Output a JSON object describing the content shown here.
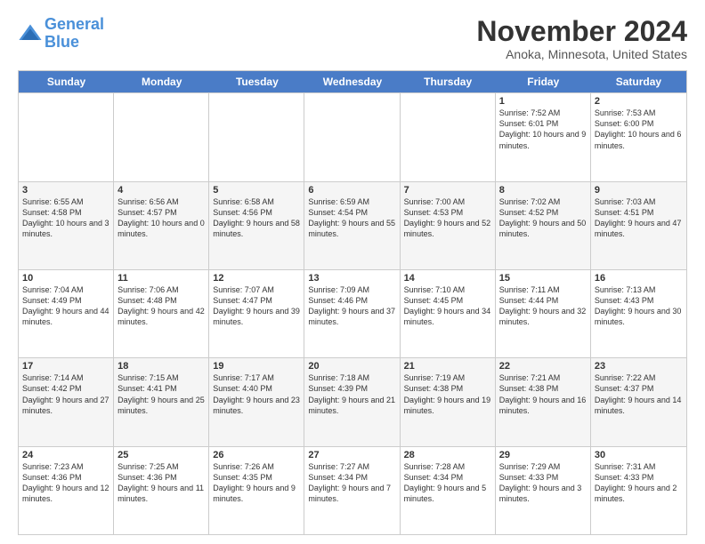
{
  "logo": {
    "line1": "General",
    "line2": "Blue"
  },
  "title": "November 2024",
  "location": "Anoka, Minnesota, United States",
  "days_of_week": [
    "Sunday",
    "Monday",
    "Tuesday",
    "Wednesday",
    "Thursday",
    "Friday",
    "Saturday"
  ],
  "weeks": [
    [
      {
        "day": "",
        "info": ""
      },
      {
        "day": "",
        "info": ""
      },
      {
        "day": "",
        "info": ""
      },
      {
        "day": "",
        "info": ""
      },
      {
        "day": "",
        "info": ""
      },
      {
        "day": "1",
        "info": "Sunrise: 7:52 AM\nSunset: 6:01 PM\nDaylight: 10 hours and 9 minutes."
      },
      {
        "day": "2",
        "info": "Sunrise: 7:53 AM\nSunset: 6:00 PM\nDaylight: 10 hours and 6 minutes."
      }
    ],
    [
      {
        "day": "3",
        "info": "Sunrise: 6:55 AM\nSunset: 4:58 PM\nDaylight: 10 hours and 3 minutes."
      },
      {
        "day": "4",
        "info": "Sunrise: 6:56 AM\nSunset: 4:57 PM\nDaylight: 10 hours and 0 minutes."
      },
      {
        "day": "5",
        "info": "Sunrise: 6:58 AM\nSunset: 4:56 PM\nDaylight: 9 hours and 58 minutes."
      },
      {
        "day": "6",
        "info": "Sunrise: 6:59 AM\nSunset: 4:54 PM\nDaylight: 9 hours and 55 minutes."
      },
      {
        "day": "7",
        "info": "Sunrise: 7:00 AM\nSunset: 4:53 PM\nDaylight: 9 hours and 52 minutes."
      },
      {
        "day": "8",
        "info": "Sunrise: 7:02 AM\nSunset: 4:52 PM\nDaylight: 9 hours and 50 minutes."
      },
      {
        "day": "9",
        "info": "Sunrise: 7:03 AM\nSunset: 4:51 PM\nDaylight: 9 hours and 47 minutes."
      }
    ],
    [
      {
        "day": "10",
        "info": "Sunrise: 7:04 AM\nSunset: 4:49 PM\nDaylight: 9 hours and 44 minutes."
      },
      {
        "day": "11",
        "info": "Sunrise: 7:06 AM\nSunset: 4:48 PM\nDaylight: 9 hours and 42 minutes."
      },
      {
        "day": "12",
        "info": "Sunrise: 7:07 AM\nSunset: 4:47 PM\nDaylight: 9 hours and 39 minutes."
      },
      {
        "day": "13",
        "info": "Sunrise: 7:09 AM\nSunset: 4:46 PM\nDaylight: 9 hours and 37 minutes."
      },
      {
        "day": "14",
        "info": "Sunrise: 7:10 AM\nSunset: 4:45 PM\nDaylight: 9 hours and 34 minutes."
      },
      {
        "day": "15",
        "info": "Sunrise: 7:11 AM\nSunset: 4:44 PM\nDaylight: 9 hours and 32 minutes."
      },
      {
        "day": "16",
        "info": "Sunrise: 7:13 AM\nSunset: 4:43 PM\nDaylight: 9 hours and 30 minutes."
      }
    ],
    [
      {
        "day": "17",
        "info": "Sunrise: 7:14 AM\nSunset: 4:42 PM\nDaylight: 9 hours and 27 minutes."
      },
      {
        "day": "18",
        "info": "Sunrise: 7:15 AM\nSunset: 4:41 PM\nDaylight: 9 hours and 25 minutes."
      },
      {
        "day": "19",
        "info": "Sunrise: 7:17 AM\nSunset: 4:40 PM\nDaylight: 9 hours and 23 minutes."
      },
      {
        "day": "20",
        "info": "Sunrise: 7:18 AM\nSunset: 4:39 PM\nDaylight: 9 hours and 21 minutes."
      },
      {
        "day": "21",
        "info": "Sunrise: 7:19 AM\nSunset: 4:38 PM\nDaylight: 9 hours and 19 minutes."
      },
      {
        "day": "22",
        "info": "Sunrise: 7:21 AM\nSunset: 4:38 PM\nDaylight: 9 hours and 16 minutes."
      },
      {
        "day": "23",
        "info": "Sunrise: 7:22 AM\nSunset: 4:37 PM\nDaylight: 9 hours and 14 minutes."
      }
    ],
    [
      {
        "day": "24",
        "info": "Sunrise: 7:23 AM\nSunset: 4:36 PM\nDaylight: 9 hours and 12 minutes."
      },
      {
        "day": "25",
        "info": "Sunrise: 7:25 AM\nSunset: 4:36 PM\nDaylight: 9 hours and 11 minutes."
      },
      {
        "day": "26",
        "info": "Sunrise: 7:26 AM\nSunset: 4:35 PM\nDaylight: 9 hours and 9 minutes."
      },
      {
        "day": "27",
        "info": "Sunrise: 7:27 AM\nSunset: 4:34 PM\nDaylight: 9 hours and 7 minutes."
      },
      {
        "day": "28",
        "info": "Sunrise: 7:28 AM\nSunset: 4:34 PM\nDaylight: 9 hours and 5 minutes."
      },
      {
        "day": "29",
        "info": "Sunrise: 7:29 AM\nSunset: 4:33 PM\nDaylight: 9 hours and 3 minutes."
      },
      {
        "day": "30",
        "info": "Sunrise: 7:31 AM\nSunset: 4:33 PM\nDaylight: 9 hours and 2 minutes."
      }
    ]
  ]
}
